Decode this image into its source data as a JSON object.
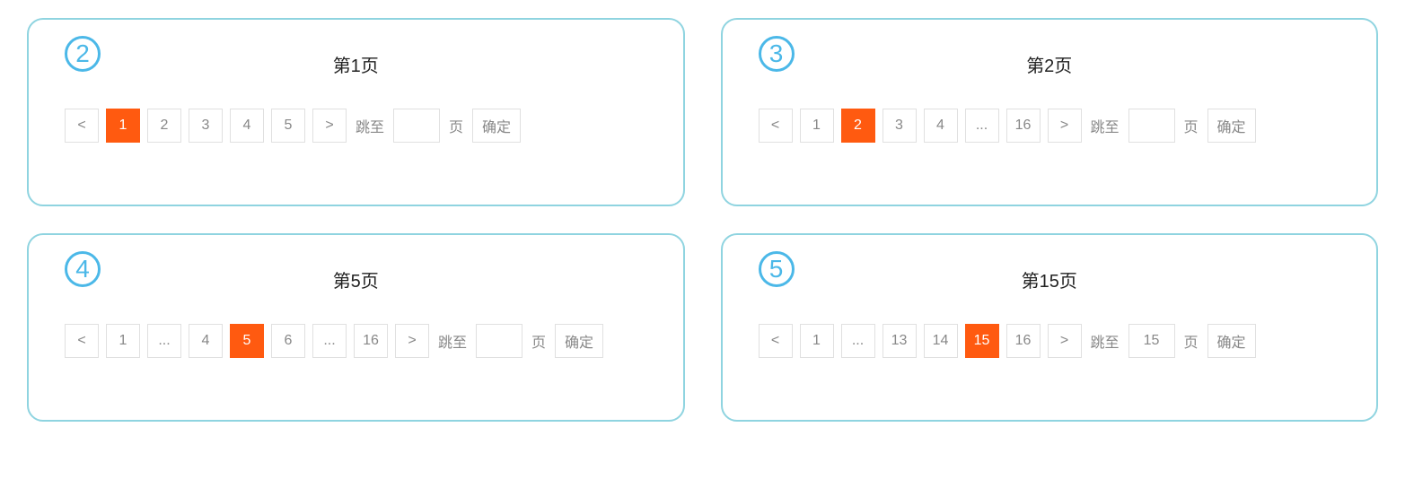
{
  "common": {
    "prev": "<",
    "next": ">",
    "ellipsis": "...",
    "jump_label": "跳至",
    "page_suffix": "页",
    "confirm": "确定"
  },
  "panels": [
    {
      "badge": "2",
      "title": "第1页",
      "pages": [
        {
          "label": "1",
          "active": true
        },
        {
          "label": "2",
          "active": false
        },
        {
          "label": "3",
          "active": false
        },
        {
          "label": "4",
          "active": false
        },
        {
          "label": "5",
          "active": false
        }
      ],
      "jump_value": ""
    },
    {
      "badge": "3",
      "title": "第2页",
      "pages": [
        {
          "label": "1",
          "active": false
        },
        {
          "label": "2",
          "active": true
        },
        {
          "label": "3",
          "active": false
        },
        {
          "label": "4",
          "active": false
        },
        {
          "label": "...",
          "active": false
        },
        {
          "label": "16",
          "active": false
        }
      ],
      "jump_value": ""
    },
    {
      "badge": "4",
      "title": "第5页",
      "pages": [
        {
          "label": "1",
          "active": false
        },
        {
          "label": "...",
          "active": false
        },
        {
          "label": "4",
          "active": false
        },
        {
          "label": "5",
          "active": true
        },
        {
          "label": "6",
          "active": false
        },
        {
          "label": "...",
          "active": false
        },
        {
          "label": "16",
          "active": false
        }
      ],
      "jump_value": ""
    },
    {
      "badge": "5",
      "title": "第15页",
      "pages": [
        {
          "label": "1",
          "active": false
        },
        {
          "label": "...",
          "active": false
        },
        {
          "label": "13",
          "active": false
        },
        {
          "label": "14",
          "active": false
        },
        {
          "label": "15",
          "active": true
        },
        {
          "label": "16",
          "active": false
        }
      ],
      "jump_value": "15"
    }
  ]
}
